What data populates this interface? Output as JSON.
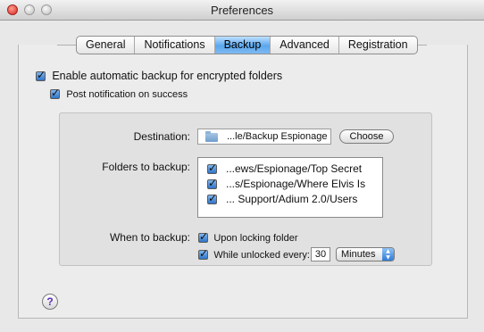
{
  "window": {
    "title": "Preferences"
  },
  "tabs": [
    {
      "label": "General",
      "active": false
    },
    {
      "label": "Notifications",
      "active": false
    },
    {
      "label": "Backup",
      "active": true
    },
    {
      "label": "Advanced",
      "active": false
    },
    {
      "label": "Registration",
      "active": false
    }
  ],
  "backup": {
    "enable_label": "Enable automatic backup for encrypted folders",
    "enable_checked": true,
    "notify_label": "Post notification on success",
    "notify_checked": true,
    "destination_label": "Destination:",
    "destination_value": "...le/Backup Espionage",
    "choose_label": "Choose",
    "folders_label": "Folders to backup:",
    "folders": [
      {
        "path": "...ews/Espionage/Top Secret",
        "checked": true
      },
      {
        "path": "...s/Espionage/Where Elvis Is",
        "checked": true
      },
      {
        "path": "... Support/Adium 2.0/Users",
        "checked": true
      }
    ],
    "when_label": "When to backup:",
    "upon_locking_label": "Upon locking folder",
    "upon_locking_checked": true,
    "while_unlocked_label": "While unlocked every:",
    "while_unlocked_checked": true,
    "interval_value": "30",
    "interval_unit": "Minutes"
  },
  "help": {
    "symbol": "?"
  },
  "colors": {
    "accent": "#4a9be8",
    "help_glyph": "#5b2fb8"
  },
  "icons": [
    "folder-icon",
    "help-icon",
    "checkbox-icon",
    "stepper-arrows-icon"
  ]
}
